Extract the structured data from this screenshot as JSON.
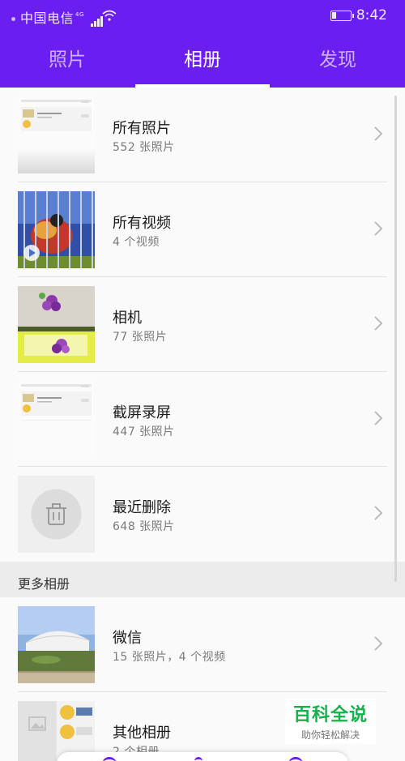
{
  "status_bar": {
    "carrier": "中国电信",
    "network": "4G",
    "time": "8:42",
    "battery_level_fraction": 0.2
  },
  "tabs": [
    {
      "label": "照片",
      "active": false
    },
    {
      "label": "相册",
      "active": true
    },
    {
      "label": "发现",
      "active": false
    }
  ],
  "albums": [
    {
      "name": "所有照片",
      "count": "552 张照片",
      "thumb": "screenshot-preview"
    },
    {
      "name": "所有视频",
      "count": "4 个视频",
      "thumb": "video-bird"
    },
    {
      "name": "相机",
      "count": "77 张照片",
      "thumb": "camera-flowers"
    },
    {
      "name": "截屏录屏",
      "count": "447 张照片",
      "thumb": "screenshot-preview"
    },
    {
      "name": "最近删除",
      "count": "648 张照片",
      "thumb": "trash-icon"
    }
  ],
  "more_section": {
    "title": "更多相册",
    "albums": [
      {
        "name": "微信",
        "count": "15 张照片，4 个视频",
        "thumb": "stadium-photo"
      },
      {
        "name": "其他相册",
        "count": "2 个相册",
        "thumb": "folder-collage"
      }
    ]
  },
  "watermark": {
    "title": "百科全说",
    "subtitle": "助你轻松解决"
  },
  "colors": {
    "header": "#6a1ff0",
    "watermark_green": "#15b14b"
  }
}
